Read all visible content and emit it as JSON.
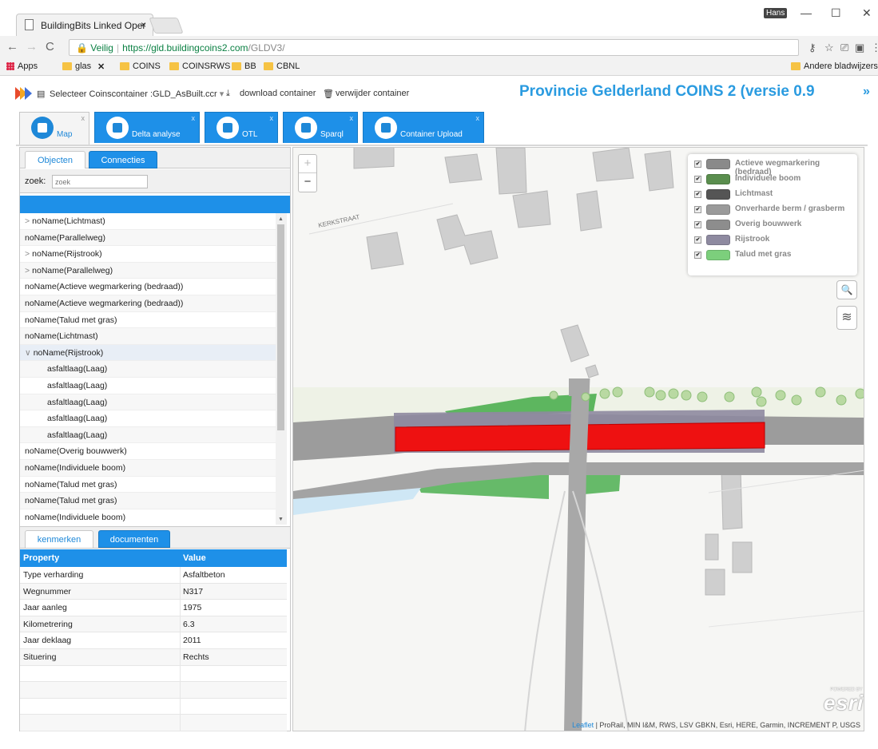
{
  "browser": {
    "tab_title": "BuildingBits Linked Oper",
    "tab_close": "×",
    "user_badge": "Hans",
    "window_minimize": "—",
    "window_maximize": "☐",
    "window_close": "✕",
    "url_secure_label": "Veilig",
    "url_host": "https://gld.buildingcoins2.com",
    "url_path": "/GLDV3/",
    "bookmarks": [
      "Apps",
      "glas",
      "COINS",
      "COINSRWS",
      "BB",
      "CBNL"
    ],
    "other_bookmarks": "Andere bladwijzers"
  },
  "toolbar": {
    "select_container": "Selecteer Coinscontainer :GLD_AsBuilt.ccr",
    "download": "download container",
    "delete": "verwijder container",
    "title": "Provincie Gelderland COINS 2 (versie 0.9",
    "expand": "»"
  },
  "main_tabs": [
    {
      "label": "Map",
      "close": "x"
    },
    {
      "label": "Delta analyse",
      "close": "x"
    },
    {
      "label": "OTL",
      "close": "x"
    },
    {
      "label": "Sparql",
      "close": "x"
    },
    {
      "label": "Container Upload",
      "close": "x"
    }
  ],
  "left": {
    "tabs": [
      "Objecten",
      "Connecties"
    ],
    "search_label": "zoek:",
    "search_placeholder": "zoek",
    "tree": [
      {
        "label": "noName(Lichtmast)",
        "caret": ">"
      },
      {
        "label": "noName(Parallelweg)",
        "caret": ""
      },
      {
        "label": "noName(Rijstrook)",
        "caret": ">"
      },
      {
        "label": "noName(Parallelweg)",
        "caret": ">"
      },
      {
        "label": "noName(Actieve wegmarkering (bedraad))",
        "caret": ""
      },
      {
        "label": "noName(Actieve wegmarkering (bedraad))",
        "caret": ""
      },
      {
        "label": "noName(Talud met gras)",
        "caret": ""
      },
      {
        "label": "noName(Lichtmast)",
        "caret": ""
      },
      {
        "label": "noName(Rijstrook)",
        "caret": "∨"
      },
      {
        "label": "asfaltlaag(Laag)",
        "caret": ""
      },
      {
        "label": "asfaltlaag(Laag)",
        "caret": ""
      },
      {
        "label": "asfaltlaag(Laag)",
        "caret": ""
      },
      {
        "label": "asfaltlaag(Laag)",
        "caret": ""
      },
      {
        "label": "asfaltlaag(Laag)",
        "caret": ""
      },
      {
        "label": "noName(Overig bouwwerk)",
        "caret": ""
      },
      {
        "label": "noName(Individuele boom)",
        "caret": ""
      },
      {
        "label": "noName(Talud met gras)",
        "caret": ""
      },
      {
        "label": "noName(Talud met gras)",
        "caret": ""
      },
      {
        "label": "noName(Individuele boom)",
        "caret": ""
      }
    ],
    "prop_tabs": [
      "kenmerken",
      "documenten"
    ],
    "prop_header": {
      "property": "Property",
      "value": "Value"
    },
    "properties": [
      {
        "key": "Type verharding",
        "value": "Asfaltbeton"
      },
      {
        "key": "Wegnummer",
        "value": "N317"
      },
      {
        "key": "Jaar aanleg",
        "value": "1975"
      },
      {
        "key": "Kilometrering",
        "value": "6.3"
      },
      {
        "key": "Jaar deklaag",
        "value": "2011"
      },
      {
        "key": "Situering",
        "value": "Rechts"
      },
      {
        "key": "",
        "value": ""
      },
      {
        "key": "",
        "value": ""
      },
      {
        "key": "",
        "value": ""
      },
      {
        "key": "",
        "value": ""
      }
    ]
  },
  "map": {
    "zoom_in": "+",
    "zoom_out": "−",
    "street_label": "KERKSTRAAT",
    "legend": [
      {
        "label": "Actieve wegmarkering (bedraad)",
        "color": "#8a8a8a"
      },
      {
        "label": "Individuele boom",
        "color": "#5a8e4e"
      },
      {
        "label": "Lichtmast",
        "color": "#555555"
      },
      {
        "label": "Onverharde berm / grasberm",
        "color": "#9a9a9a"
      },
      {
        "label": "Overig bouwwerk",
        "color": "#8d8d8d"
      },
      {
        "label": "Rijstrook",
        "color": "#8e8aa0"
      },
      {
        "label": "Talud met gras",
        "color": "#7ccf7c"
      }
    ],
    "legend_checkmark": "✔",
    "search_icon": "🔍",
    "attribution_leaflet": "Leaflet",
    "attribution": " | ProRail, MIN I&M, RWS, LSV GBKN, Esri, HERE, Garmin, INCREMENT P, USGS",
    "esri_powered": "POWERED BY",
    "esri_logo": "esri"
  }
}
